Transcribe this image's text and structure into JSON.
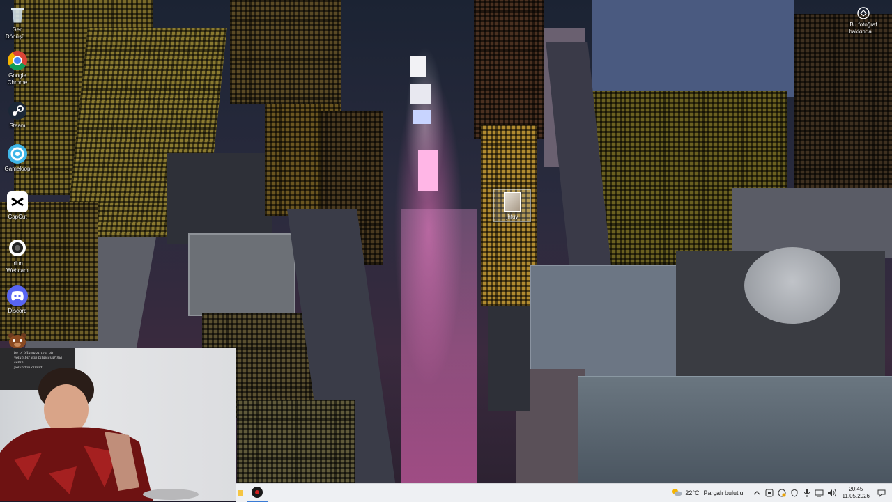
{
  "desktop": {
    "icons": [
      {
        "id": "recycle-bin",
        "label": "Geri\nDönüşü...",
        "icon": "recycle-bin-icon"
      },
      {
        "id": "google-chrome",
        "label": "Google\nChrome",
        "icon": "chrome-icon"
      },
      {
        "id": "steam",
        "label": "Steam",
        "icon": "steam-icon"
      },
      {
        "id": "gameloop",
        "label": "Gameloop",
        "icon": "gameloop-icon"
      },
      {
        "id": "capcut",
        "label": "CapCut",
        "icon": "capcut-icon"
      },
      {
        "id": "iriun-webcam",
        "label": "Iriun\nWebcam",
        "icon": "webcam-icon"
      },
      {
        "id": "discord",
        "label": "Discord",
        "icon": "discord-icon"
      },
      {
        "id": "fnaf-game",
        "label": "",
        "icon": "freddy-icon"
      }
    ],
    "file": {
      "label": "jhfuy",
      "icon": "image-file-icon"
    },
    "photo_info": {
      "label": "Bu fotoğraf\nhakkında ..."
    }
  },
  "webcam_overlay": {
    "poster_lines": [
      "be ol bilgisayarıma gir,",
      "yolun bir yap bilgisayarıma senin",
      "yolundan olmadı..."
    ]
  },
  "taskbar": {
    "weather": {
      "temp": "22°C",
      "condition": "Parçalı bulutlu"
    },
    "clock": {
      "time": "20:45",
      "date": "11.05.2026"
    }
  },
  "colors": {
    "taskbar_bg": "#eef0f3",
    "accent": "#5865f2"
  }
}
